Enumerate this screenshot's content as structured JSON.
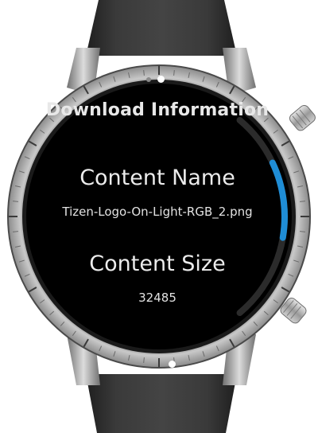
{
  "screen": {
    "title": "Download Information",
    "content_name": {
      "label": "Content Name",
      "value": "Tizen-Logo-On-Light-RGB_2.png"
    },
    "content_size": {
      "label": "Content Size",
      "value": "32485"
    },
    "page_indicator": {
      "pages": 2,
      "active": 2
    }
  },
  "scrollbar": {
    "position": 0.38,
    "thumb_fraction": 0.35
  },
  "colors": {
    "screen_background": "#000000",
    "text_primary": "#ececec",
    "scrollbar_track": "#2b2b2b",
    "scrollbar_thumb": "#1f8dd6",
    "strap": "#2e2e2e",
    "bezel": "#b8b8b8"
  }
}
